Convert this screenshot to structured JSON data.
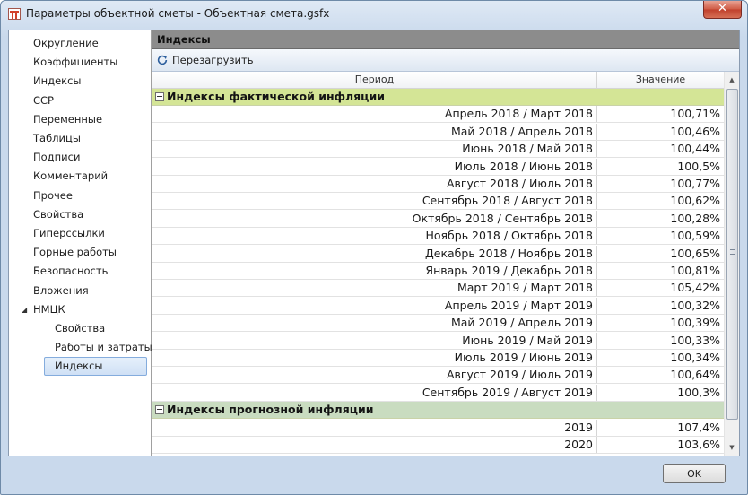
{
  "window": {
    "title": "Параметры объектной сметы - Объектная смета.gsfx",
    "close_label": "✕"
  },
  "sidebar": {
    "items": [
      {
        "label": "Округление"
      },
      {
        "label": "Коэффициенты"
      },
      {
        "label": "Индексы"
      },
      {
        "label": "ССР"
      },
      {
        "label": "Переменные"
      },
      {
        "label": "Таблицы"
      },
      {
        "label": "Подписи"
      },
      {
        "label": "Комментарий"
      },
      {
        "label": "Прочее"
      },
      {
        "label": "Свойства"
      },
      {
        "label": "Гиперссылки"
      },
      {
        "label": "Горные работы"
      },
      {
        "label": "Безопасность"
      },
      {
        "label": "Вложения"
      },
      {
        "label": "НМЦК",
        "expanded": true
      },
      {
        "label": "Свойства"
      },
      {
        "label": "Работы и затраты"
      },
      {
        "label": "Индексы",
        "selected": true
      }
    ],
    "expand_glyph": "◢"
  },
  "panel": {
    "header": "Индексы",
    "reload_label": "Перезагрузить"
  },
  "grid": {
    "columns": {
      "period": "Период",
      "value": "Значение"
    },
    "group_actual": "Индексы фактической инфляции",
    "actual_rows": [
      {
        "period": "Апрель 2018 / Март 2018",
        "value": "100,71%"
      },
      {
        "period": "Май 2018 / Апрель 2018",
        "value": "100,46%"
      },
      {
        "period": "Июнь 2018 / Май 2018",
        "value": "100,44%"
      },
      {
        "period": "Июль 2018 / Июнь 2018",
        "value": "100,5%"
      },
      {
        "period": "Август 2018 / Июль 2018",
        "value": "100,77%"
      },
      {
        "period": "Сентябрь 2018 / Август 2018",
        "value": "100,62%"
      },
      {
        "period": "Октябрь 2018 / Сентябрь 2018",
        "value": "100,28%"
      },
      {
        "period": "Ноябрь 2018 / Октябрь 2018",
        "value": "100,59%"
      },
      {
        "period": "Декабрь 2018 / Ноябрь 2018",
        "value": "100,65%"
      },
      {
        "period": "Январь 2019 / Декабрь 2018",
        "value": "100,81%"
      },
      {
        "period": "Март 2019 / Март 2018",
        "value": "105,42%"
      },
      {
        "period": "Апрель 2019 / Март 2019",
        "value": "100,32%"
      },
      {
        "period": "Май 2019 / Апрель 2019",
        "value": "100,39%"
      },
      {
        "period": "Июнь 2019 / Май 2019",
        "value": "100,33%"
      },
      {
        "period": "Июль 2019 / Июнь 2019",
        "value": "100,34%"
      },
      {
        "period": "Август 2019 / Июль 2019",
        "value": "100,64%"
      },
      {
        "period": "Сентябрь 2019 / Август 2019",
        "value": "100,3%"
      }
    ],
    "group_forecast": "Индексы прогнозной инфляции",
    "forecast_rows": [
      {
        "period": "2019",
        "value": "107,4%"
      },
      {
        "period": "2020",
        "value": "103,6%"
      }
    ],
    "scroll_up_glyph": "▲",
    "scroll_down_glyph": "▼"
  },
  "footer": {
    "ok_label": "OK"
  },
  "colors": {
    "group_actual_bg": "#d4e596",
    "group_forecast_bg": "#c9dcc0",
    "panel_header_bg": "#8c8c8c",
    "close_button": "#c0402c"
  }
}
